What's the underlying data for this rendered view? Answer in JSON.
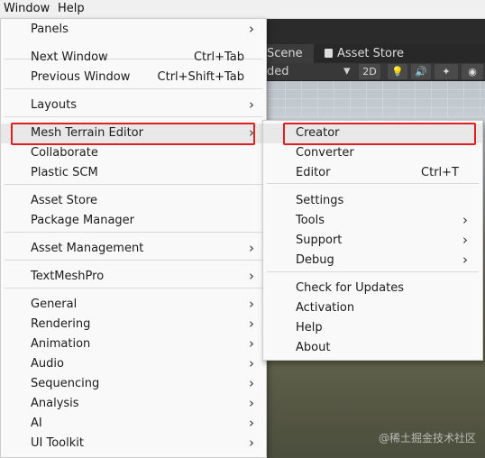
{
  "menubar": {
    "window": "Window",
    "help": "Help"
  },
  "editor": {
    "tab_scene": "Scene",
    "tab_asset_store": "Asset Store",
    "toolbar_shaded": "ded",
    "toolbar_2d": "2D"
  },
  "window_menu": [
    {
      "label": "Panels",
      "arrow": true
    },
    {
      "label": "Next Window",
      "shortcut": "Ctrl+Tab"
    },
    {
      "label": "Previous Window",
      "shortcut": "Ctrl+Shift+Tab"
    },
    {
      "label": "Layouts",
      "arrow": true
    },
    {
      "label": "Mesh Terrain Editor",
      "arrow": true
    },
    {
      "label": "Collaborate"
    },
    {
      "label": "Plastic SCM"
    },
    {
      "label": "Asset Store"
    },
    {
      "label": "Package Manager"
    },
    {
      "label": "Asset Management",
      "arrow": true
    },
    {
      "label": "TextMeshPro",
      "arrow": true
    },
    {
      "label": "General",
      "arrow": true
    },
    {
      "label": "Rendering",
      "arrow": true
    },
    {
      "label": "Animation",
      "arrow": true
    },
    {
      "label": "Audio",
      "arrow": true
    },
    {
      "label": "Sequencing",
      "arrow": true
    },
    {
      "label": "Analysis",
      "arrow": true
    },
    {
      "label": "AI",
      "arrow": true
    },
    {
      "label": "UI Toolkit",
      "arrow": true
    }
  ],
  "submenu": [
    {
      "label": "Creator"
    },
    {
      "label": "Converter"
    },
    {
      "label": "Editor",
      "shortcut": "Ctrl+T"
    },
    {
      "label": "Settings"
    },
    {
      "label": "Tools",
      "arrow": true
    },
    {
      "label": "Support",
      "arrow": true
    },
    {
      "label": "Debug",
      "arrow": true
    },
    {
      "label": "Check for Updates"
    },
    {
      "label": "Activation"
    },
    {
      "label": "Help"
    },
    {
      "label": "About"
    }
  ],
  "arrow_glyph": "›",
  "watermark": "@稀土掘金技术社区",
  "highlight_color": "#e02020"
}
